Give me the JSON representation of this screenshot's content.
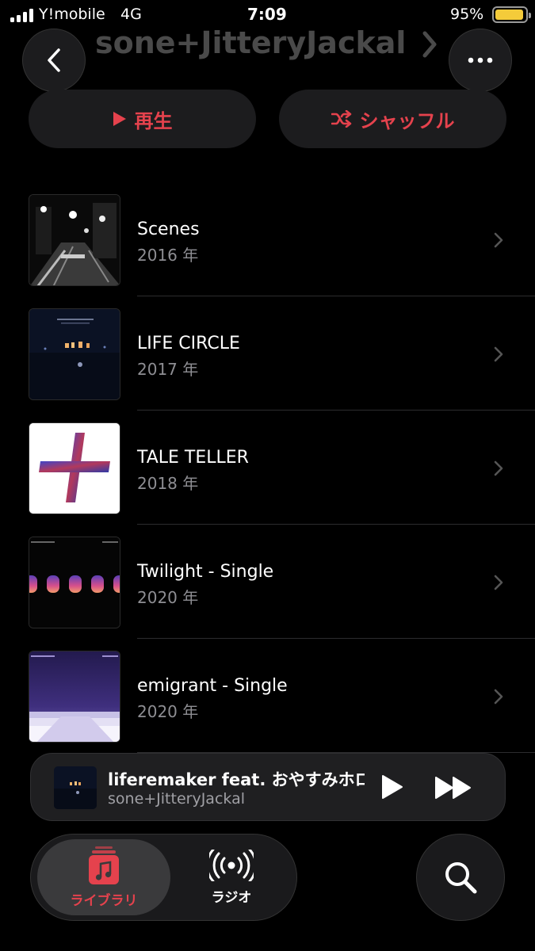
{
  "status_bar": {
    "carrier": "Y!mobile",
    "network": "4G",
    "time": "7:09",
    "battery": "95%",
    "battery_level": 0.95,
    "battery_color": "#f4cb3a"
  },
  "header": {
    "title": "sone+JitteryJackal",
    "back_icon": "chevron-left-icon",
    "more_icon": "ellipsis-icon"
  },
  "actions": {
    "play_label": "再生",
    "shuffle_label": "シャッフル",
    "accent_color": "#e5424d"
  },
  "albums": [
    {
      "title": "Scenes",
      "year": "2016 年"
    },
    {
      "title": "LIFE CIRCLE",
      "year": "2017 年"
    },
    {
      "title": "TALE TELLER",
      "year": "2018 年"
    },
    {
      "title": "Twilight - Single",
      "year": "2020 年"
    },
    {
      "title": "emigrant - Single",
      "year": "2020 年"
    }
  ],
  "now_playing": {
    "song": "liferemaker feat. おやすみホロ",
    "artist": "sone+JitteryJackal"
  },
  "tabs": {
    "library": "ライブラリ",
    "radio": "ラジオ",
    "active": "library"
  }
}
